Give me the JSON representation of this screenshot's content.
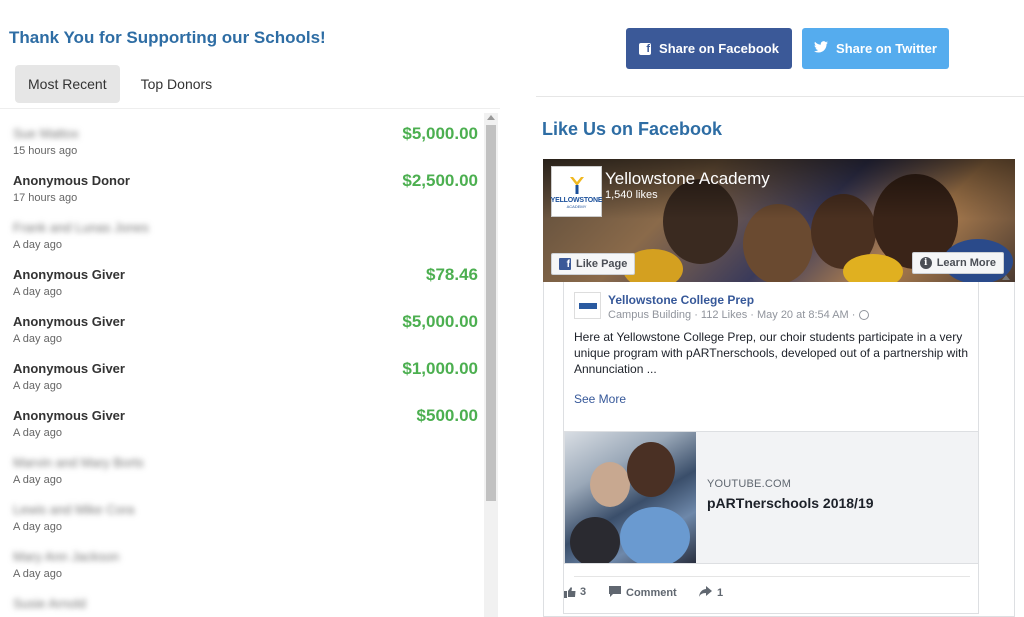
{
  "left": {
    "title": "Thank You for Supporting our Schools!",
    "tabs": [
      {
        "label": "Most Recent",
        "active": true
      },
      {
        "label": "Top Donors",
        "active": false
      }
    ],
    "donors": [
      {
        "name": "Sue Mattox",
        "time": "15 hours ago",
        "amount": "$5,000.00",
        "blurred": true
      },
      {
        "name": "Anonymous Donor",
        "time": "17 hours ago",
        "amount": "$2,500.00",
        "blurred": false
      },
      {
        "name": "Frank and Lunas Jones",
        "time": "A day ago",
        "amount": "",
        "blurred": true
      },
      {
        "name": "Anonymous Giver",
        "time": "A day ago",
        "amount": "$78.46",
        "blurred": false
      },
      {
        "name": "Anonymous Giver",
        "time": "A day ago",
        "amount": "$5,000.00",
        "blurred": false
      },
      {
        "name": "Anonymous Giver",
        "time": "A day ago",
        "amount": "$1,000.00",
        "blurred": false
      },
      {
        "name": "Anonymous Giver",
        "time": "A day ago",
        "amount": "$500.00",
        "blurred": false
      },
      {
        "name": "Marvin and Mary Borts",
        "time": "A day ago",
        "amount": "",
        "blurred": true
      },
      {
        "name": "Lewis and Mike Cora",
        "time": "A day ago",
        "amount": "",
        "blurred": true
      },
      {
        "name": "Mary Ann Jackson",
        "time": "A day ago",
        "amount": "",
        "blurred": true
      },
      {
        "name": "Susie Arnold",
        "time": "",
        "amount": "",
        "blurred": true
      }
    ]
  },
  "share": {
    "facebook_label": "Share on Facebook",
    "twitter_label": "Share on Twitter"
  },
  "facebook": {
    "section_title": "Like Us on Facebook",
    "page_name": "Yellowstone Academy",
    "page_likes": "1,540 likes",
    "logo_text": "YELLOWSTONE",
    "logo_sub": "ACADEMY",
    "like_page_label": "Like Page",
    "learn_more_label": "Learn More",
    "post": {
      "author": "Yellowstone College Prep",
      "meta": "Campus Building · 112 Likes · May 20 at 8:54 AM ·",
      "text": "Here at Yellowstone College Prep, our choir students participate in a very unique program with pARTnerschools, developed out of a partnership with Annunciation ...",
      "see_more": "See More",
      "link_domain": "YOUTUBE.COM",
      "link_title": "pARTnerschools 2018/19",
      "likes": "3",
      "comment_label": "Comment",
      "shares": "1"
    }
  },
  "colors": {
    "title_blue": "#2e6da4",
    "amount_green": "#4caf50",
    "facebook_blue": "#3b5998",
    "twitter_blue": "#55acee"
  }
}
